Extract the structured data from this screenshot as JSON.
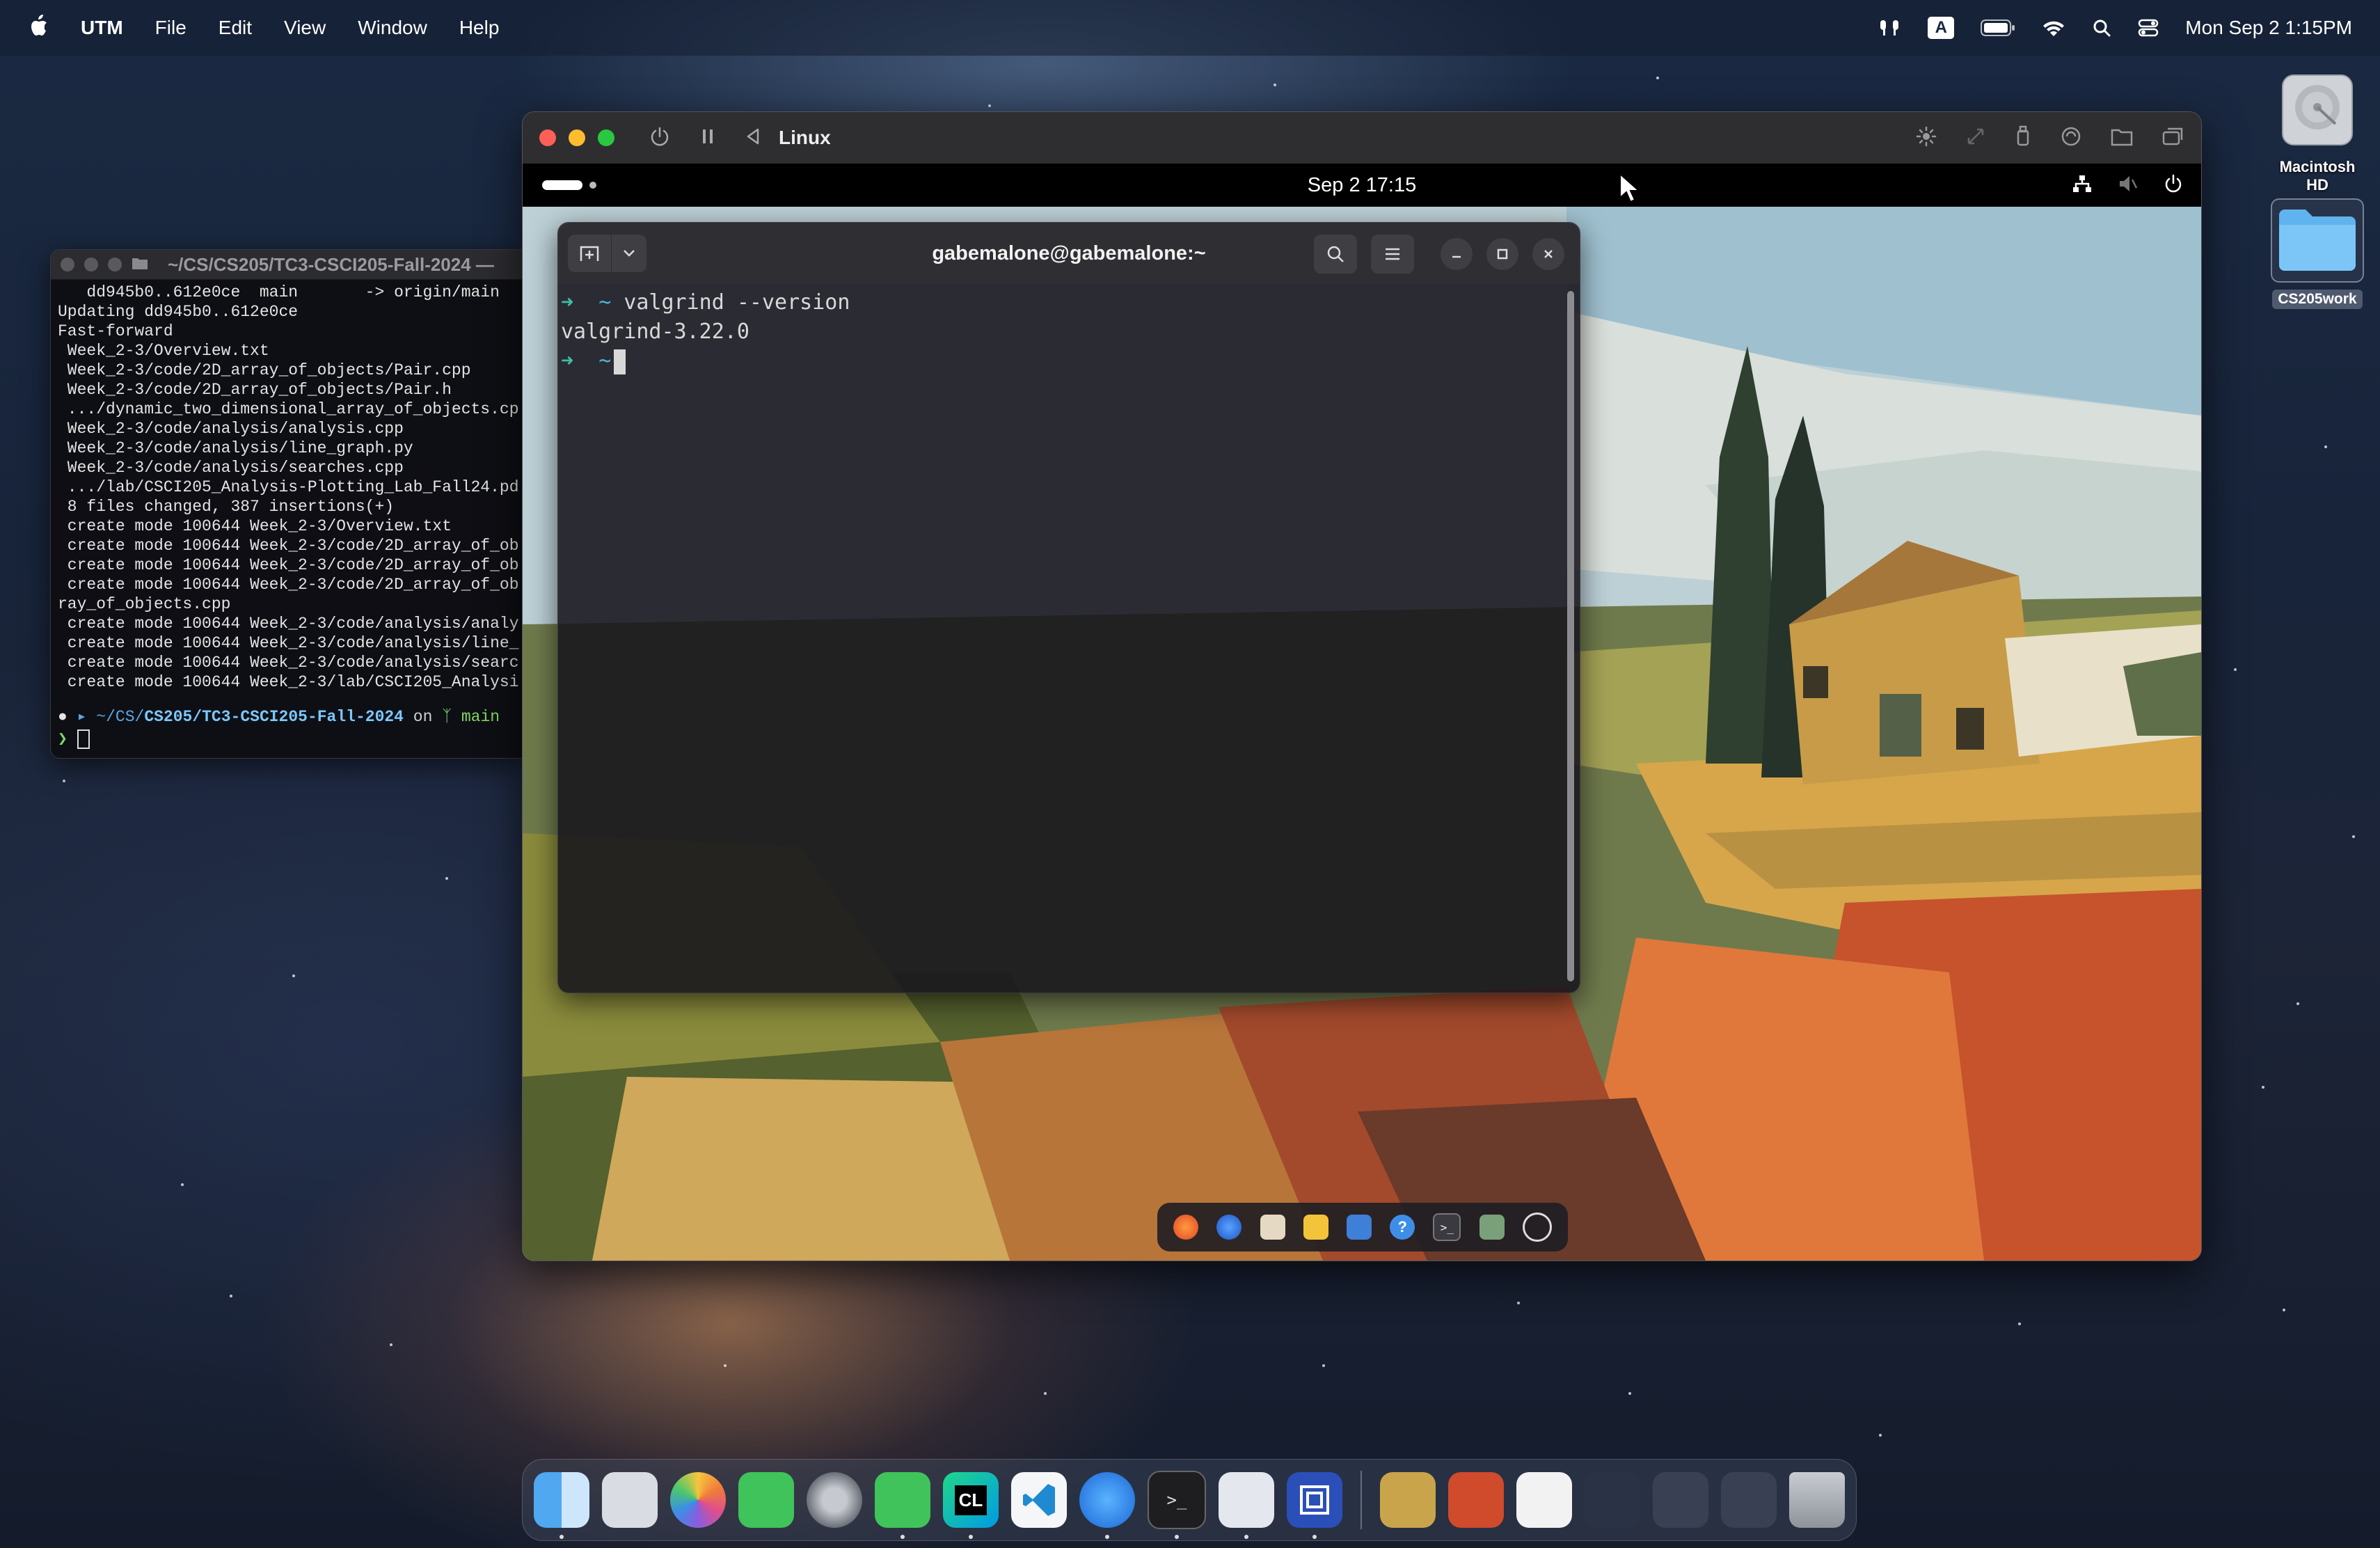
{
  "menubar": {
    "app_name": "UTM",
    "menus": [
      "File",
      "Edit",
      "View",
      "Window",
      "Help"
    ],
    "input_source": "A",
    "clock": "Mon Sep 2  1:15PM"
  },
  "desktop": {
    "drive_label": "Macintosh HD",
    "folder_label": "CS205work"
  },
  "mac_terminal": {
    "title": "~/CS/CS205/TC3-CSCI205-Fall-2024 —",
    "lines": [
      "   dd945b0..612e0ce  main       -> origin/main",
      "Updating dd945b0..612e0ce",
      "Fast-forward",
      " Week_2-3/Overview.txt",
      " Week_2-3/code/2D_array_of_objects/Pair.cpp",
      " Week_2-3/code/2D_array_of_objects/Pair.h",
      " .../dynamic_two_dimensional_array_of_objects.cp",
      " Week_2-3/code/analysis/analysis.cpp",
      " Week_2-3/code/analysis/line_graph.py",
      " Week_2-3/code/analysis/searches.cpp",
      " .../lab/CSCI205_Analysis-Plotting_Lab_Fall24.pd",
      " 8 files changed, 387 insertions(+)",
      " create mode 100644 Week_2-3/Overview.txt",
      " create mode 100644 Week_2-3/code/2D_array_of_ob",
      " create mode 100644 Week_2-3/code/2D_array_of_ob",
      " create mode 100644 Week_2-3/code/2D_array_of_ob",
      "ray_of_objects.cpp",
      " create mode 100644 Week_2-3/code/analysis/analy",
      " create mode 100644 Week_2-3/code/analysis/line_",
      " create mode 100644 Week_2-3/code/analysis/searc",
      " create mode 100644 Week_2-3/lab/CSCI205_Analysi"
    ],
    "prompt_path_prefix": "~/CS/",
    "prompt_path_bold": "CS205/TC3-CSCI205-Fall-2024",
    "prompt_on": "on",
    "prompt_branch": "main",
    "prompt_char": "❯"
  },
  "utm_window": {
    "vm_name": "Linux",
    "gnome": {
      "datetime": "Sep 2  17:15"
    },
    "terminal": {
      "title": "gabemalone@gabemalone:~",
      "prompt_arrow": "➜",
      "prompt_dir": "~",
      "command": "valgrind --version",
      "output": "valgrind-3.22.0"
    }
  },
  "colors": {
    "close": "#ff5f57",
    "minimize": "#febc2e",
    "zoom": "#28c840",
    "prompt_arrow": "#3fbfa4"
  }
}
